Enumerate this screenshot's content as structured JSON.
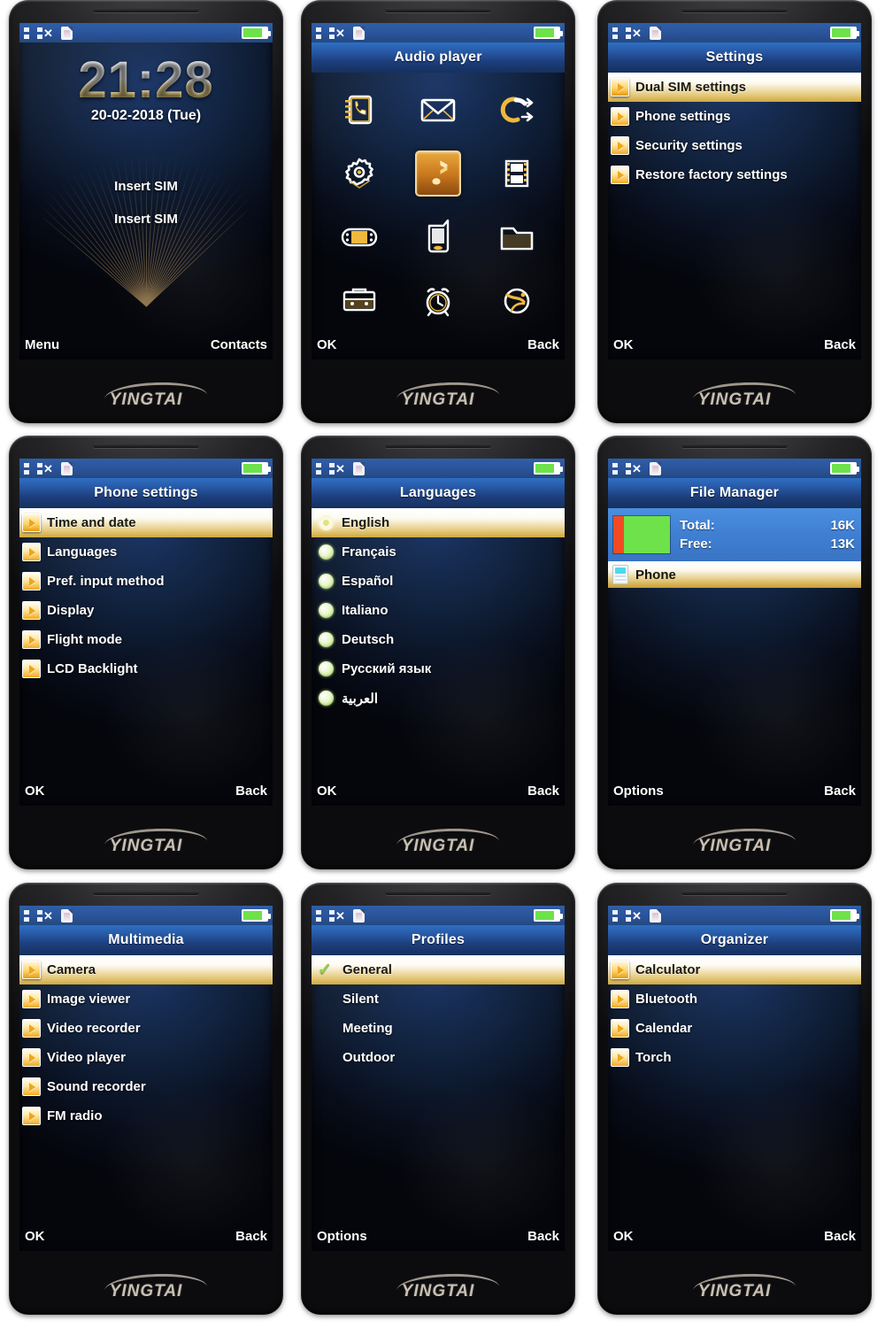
{
  "brand": "YINGTAI",
  "status": {
    "signal_icon": "signal-bars-icon",
    "no_sim_icon": "sim-missing-icon",
    "sim_icon": "sim-card-icon",
    "battery_icon": "battery-icon",
    "battery_level": 80
  },
  "screens": [
    {
      "id": "idle",
      "type": "idle",
      "clock": "21:28",
      "date": "20-02-2018  (Tue)",
      "sim1_text": "Insert SIM",
      "sim2_text": "Insert SIM",
      "softkey_left": "Menu",
      "softkey_right": "Contacts"
    },
    {
      "id": "main-menu",
      "type": "icongrid",
      "title": "Audio player",
      "softkey_left": "OK",
      "softkey_right": "Back",
      "icons": [
        {
          "name": "phonebook-icon",
          "selected": false
        },
        {
          "name": "messages-envelope-icon",
          "selected": false
        },
        {
          "name": "call-center-icon",
          "selected": false
        },
        {
          "name": "settings-gear-icon",
          "selected": false
        },
        {
          "name": "audio-player-note-icon",
          "selected": true
        },
        {
          "name": "video-film-icon",
          "selected": false
        },
        {
          "name": "games-gamepad-icon",
          "selected": false
        },
        {
          "name": "profiles-handset-icon",
          "selected": false
        },
        {
          "name": "file-manager-folder-icon",
          "selected": false
        },
        {
          "name": "organizer-toolbox-icon",
          "selected": false
        },
        {
          "name": "alarm-clock-icon",
          "selected": false
        },
        {
          "name": "services-globe-icon",
          "selected": false
        }
      ]
    },
    {
      "id": "settings",
      "type": "list",
      "title": "Settings",
      "softkey_left": "OK",
      "softkey_right": "Back",
      "items": [
        {
          "label": "Dual SIM settings",
          "selected": true
        },
        {
          "label": "Phone settings",
          "selected": false
        },
        {
          "label": "Security settings",
          "selected": false
        },
        {
          "label": "Restore factory settings",
          "selected": false
        }
      ]
    },
    {
      "id": "phone-settings",
      "type": "list",
      "title": "Phone settings",
      "softkey_left": "OK",
      "softkey_right": "Back",
      "items": [
        {
          "label": "Time and date",
          "selected": true
        },
        {
          "label": "Languages",
          "selected": false
        },
        {
          "label": "Pref. input method",
          "selected": false
        },
        {
          "label": "Display",
          "selected": false
        },
        {
          "label": "Flight mode",
          "selected": false
        },
        {
          "label": "LCD Backlight",
          "selected": false
        }
      ]
    },
    {
      "id": "languages",
      "type": "radiolist",
      "title": "Languages",
      "softkey_left": "OK",
      "softkey_right": "Back",
      "items": [
        {
          "label": "English",
          "selected": true
        },
        {
          "label": "Français",
          "selected": false
        },
        {
          "label": "Español",
          "selected": false
        },
        {
          "label": "Italiano",
          "selected": false
        },
        {
          "label": "Deutsch",
          "selected": false
        },
        {
          "label": "Русский язык",
          "selected": false
        },
        {
          "label": "العربية",
          "selected": false
        }
      ]
    },
    {
      "id": "file-manager",
      "type": "filemanager",
      "title": "File Manager",
      "softkey_left": "Options",
      "softkey_right": "Back",
      "total_label": "Total:",
      "total_value": "16K",
      "free_label": "Free:",
      "free_value": "13K",
      "used_percent": 19,
      "free_percent": 81,
      "used_color": "#f04b22",
      "free_color": "#6ee24a",
      "items": [
        {
          "label": "Phone",
          "selected": true,
          "icon": "phone-storage-icon"
        }
      ]
    },
    {
      "id": "multimedia",
      "type": "list",
      "title": "Multimedia",
      "softkey_left": "OK",
      "softkey_right": "Back",
      "items": [
        {
          "label": "Camera",
          "selected": true
        },
        {
          "label": "Image viewer",
          "selected": false
        },
        {
          "label": "Video recorder",
          "selected": false
        },
        {
          "label": "Video player",
          "selected": false
        },
        {
          "label": "Sound recorder",
          "selected": false
        },
        {
          "label": "FM radio",
          "selected": false
        }
      ]
    },
    {
      "id": "profiles",
      "type": "checklist",
      "title": "Profiles",
      "softkey_left": "Options",
      "softkey_right": "Back",
      "items": [
        {
          "label": "General",
          "selected": true,
          "checked": true
        },
        {
          "label": "Silent",
          "selected": false,
          "checked": false
        },
        {
          "label": "Meeting",
          "selected": false,
          "checked": false
        },
        {
          "label": "Outdoor",
          "selected": false,
          "checked": false
        }
      ]
    },
    {
      "id": "organizer",
      "type": "list",
      "title": "Organizer",
      "softkey_left": "OK",
      "softkey_right": "Back",
      "items": [
        {
          "label": "Calculator",
          "selected": true
        },
        {
          "label": "Bluetooth",
          "selected": false
        },
        {
          "label": "Calendar",
          "selected": false
        },
        {
          "label": "Torch",
          "selected": false
        }
      ]
    }
  ]
}
